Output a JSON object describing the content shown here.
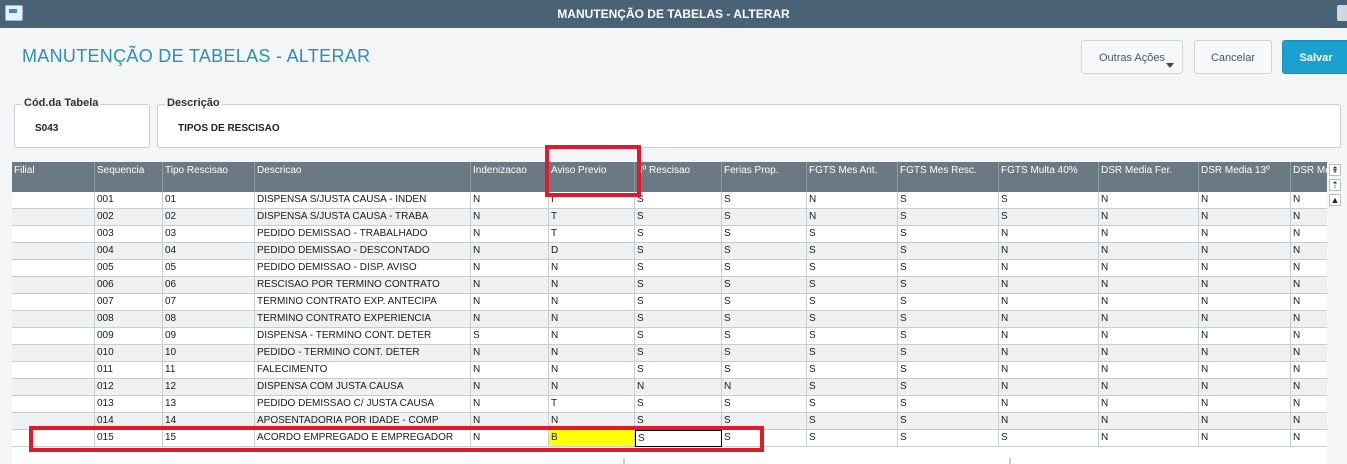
{
  "window": {
    "title": "MANUTENÇÃO DE TABELAS - ALTERAR"
  },
  "page": {
    "title": "MANUTENÇÃO DE TABELAS - ALTERAR"
  },
  "toolbar": {
    "more_actions_label": "Outras Ações",
    "cancel_label": "Cancelar",
    "save_label": "Salvar"
  },
  "colors": {
    "accent": "#1aa1cf",
    "title": "#2a8fb8",
    "highlight": "#ffff00",
    "annotation": "#e0192b",
    "header_bg": "#6a7983"
  },
  "form": {
    "code_label": "Cód.da Tabela",
    "code_value": "S043",
    "description_label": "Descrição",
    "description_value": "TIPOS DE RESCISAO"
  },
  "grid": {
    "columns": [
      "Filial",
      "Sequencia",
      "Tipo Rescisao",
      "Descricao",
      "Indenizacao",
      "Aviso Previo",
      "3º Rescisao",
      "Ferias Prop.",
      "FGTS Mes Ant.",
      "FGTS Mes Resc.",
      "FGTS Multa 40%",
      "DSR Media Fer.",
      "DSR Media 13º",
      "DSR Me"
    ],
    "rows": [
      [
        "",
        "001",
        "01",
        "DISPENSA S/JUSTA CAUSA - INDEN",
        "N",
        "I",
        "S",
        "S",
        "N",
        "S",
        "S",
        "N",
        "N",
        "N"
      ],
      [
        "",
        "002",
        "02",
        "DISPENSA S/JUSTA CAUSA - TRABA",
        "N",
        "T",
        "S",
        "S",
        "N",
        "S",
        "S",
        "N",
        "N",
        "N"
      ],
      [
        "",
        "003",
        "03",
        "PEDIDO DEMISSAO - TRABALHADO",
        "N",
        "T",
        "S",
        "S",
        "S",
        "S",
        "N",
        "N",
        "N",
        "N"
      ],
      [
        "",
        "004",
        "04",
        "PEDIDO DEMISSAO - DESCONTADO",
        "N",
        "D",
        "S",
        "S",
        "S",
        "S",
        "N",
        "N",
        "N",
        "N"
      ],
      [
        "",
        "005",
        "05",
        "PEDIDO DEMISSAO - DISP. AVISO",
        "N",
        "N",
        "S",
        "S",
        "S",
        "S",
        "N",
        "N",
        "N",
        "N"
      ],
      [
        "",
        "006",
        "06",
        "RESCISAO POR TERMINO CONTRATO",
        "N",
        "N",
        "S",
        "S",
        "S",
        "S",
        "N",
        "N",
        "N",
        "N"
      ],
      [
        "",
        "007",
        "07",
        "TERMINO CONTRATO EXP. ANTECIPA",
        "N",
        "N",
        "S",
        "S",
        "S",
        "S",
        "N",
        "N",
        "N",
        "N"
      ],
      [
        "",
        "008",
        "08",
        "TERMINO CONTRATO EXPERIENCIA",
        "N",
        "N",
        "S",
        "S",
        "S",
        "S",
        "N",
        "N",
        "N",
        "N"
      ],
      [
        "",
        "009",
        "09",
        "DISPENSA - TERMINO CONT. DETER",
        "S",
        "N",
        "S",
        "S",
        "S",
        "S",
        "N",
        "N",
        "N",
        "N"
      ],
      [
        "",
        "010",
        "10",
        "PEDIDO - TERMINO CONT. DETER",
        "N",
        "N",
        "S",
        "S",
        "S",
        "S",
        "N",
        "N",
        "N",
        "N"
      ],
      [
        "",
        "011",
        "11",
        "FALECIMENTO",
        "N",
        "N",
        "S",
        "S",
        "S",
        "S",
        "N",
        "N",
        "N",
        "N"
      ],
      [
        "",
        "012",
        "12",
        "DISPENSA COM JUSTA CAUSA",
        "N",
        "N",
        "N",
        "N",
        "S",
        "S",
        "N",
        "N",
        "N",
        "N"
      ],
      [
        "",
        "013",
        "13",
        "PEDIDO DEMISSAO C/ JUSTA CAUSA",
        "N",
        "T",
        "S",
        "S",
        "S",
        "S",
        "N",
        "N",
        "N",
        "N"
      ],
      [
        "",
        "014",
        "14",
        "APOSENTADORIA POR IDADE - COMP",
        "N",
        "N",
        "S",
        "S",
        "S",
        "S",
        "N",
        "N",
        "N",
        "N"
      ],
      [
        "",
        "015",
        "15",
        "ACORDO EMPREGADO E EMPREGADOR",
        "N",
        "B",
        "S",
        "S",
        "S",
        "S",
        "S",
        "N",
        "N",
        "N"
      ]
    ]
  },
  "scrollbar": {
    "icons": [
      "scroll-top-icon",
      "page-up-icon",
      "scroll-up-icon"
    ]
  }
}
